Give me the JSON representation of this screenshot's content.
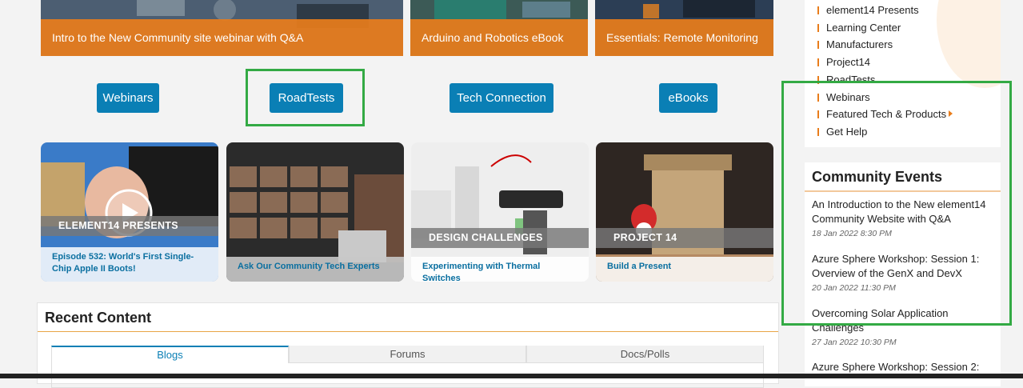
{
  "banners": [
    {
      "caption": "Intro to the New Community site webinar with Q&A"
    },
    {
      "caption": "Arduino and Robotics eBook"
    },
    {
      "caption": "Essentials: Remote Monitoring"
    }
  ],
  "categories": [
    "Webinars",
    "RoadTests",
    "Tech Connection",
    "eBooks"
  ],
  "tiles": [
    {
      "band": "ELEMENT14 PRESENTS",
      "link": "Episode 532: World's First Single-Chip Apple II Boots!"
    },
    {
      "band": "",
      "link": "Ask Our Community Tech Experts"
    },
    {
      "band": "DESIGN CHALLENGES",
      "link": "Experimenting with Thermal Switches"
    },
    {
      "band": "PROJECT 14",
      "link": "Build a Present"
    }
  ],
  "recent": {
    "title": "Recent Content",
    "tabs": [
      "Blogs",
      "Forums",
      "Docs/Polls"
    ]
  },
  "sidebar": {
    "nav": [
      "element14 Presents",
      "Learning Center",
      "Manufacturers",
      "Project14",
      "RoadTests",
      "Webinars",
      "Featured Tech & Products",
      "Get Help"
    ]
  },
  "events": {
    "title": "Community Events",
    "items": [
      {
        "title": "An Introduction to the New element14 Community Website with Q&A",
        "date": "18 Jan 2022 8:30 PM"
      },
      {
        "title": "Azure Sphere Workshop: Session 1: Overview of the GenX and DevX",
        "date": "20 Jan 2022 11:30 PM"
      },
      {
        "title": "Overcoming Solar Application Challenges",
        "date": "27 Jan 2022 10:30 PM"
      },
      {
        "title": "Azure Sphere Workshop: Session 2:",
        "date": ""
      }
    ]
  },
  "colors": {
    "accent": "#0a7fb5",
    "orange": "#e97d1b",
    "highlight": "#33aa44"
  }
}
